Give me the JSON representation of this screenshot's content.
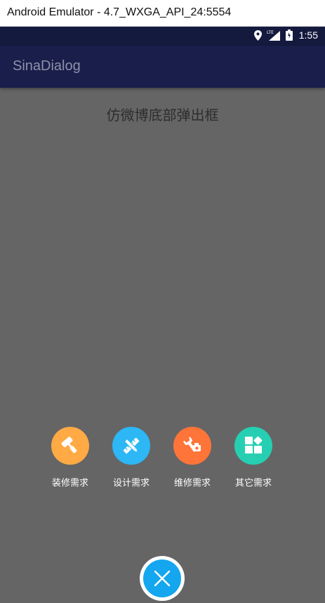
{
  "window": {
    "title": "Android Emulator - 4.7_WXGA_API_24:5554"
  },
  "status_bar": {
    "time": "1:55",
    "network_label": "LTE",
    "icons": [
      "location-pin-icon",
      "signal-icon",
      "battery-icon"
    ],
    "color": "#141a3e"
  },
  "app_bar": {
    "title": "SinaDialog",
    "color": "#191e4b"
  },
  "page": {
    "heading": "仿微博底部弹出框"
  },
  "menu": {
    "items": [
      {
        "label": "装修需求",
        "icon": "paint-roller-icon",
        "color": "#ffaa45"
      },
      {
        "label": "设计需求",
        "icon": "ruler-pencil-icon",
        "color": "#2db7f5"
      },
      {
        "label": "维修需求",
        "icon": "wrench-icon",
        "color": "#ff7438"
      },
      {
        "label": "其它需求",
        "icon": "grid-apps-icon",
        "color": "#27cfb2"
      }
    ]
  },
  "close_button": {
    "icon": "close-icon",
    "color": "#14a6ee"
  },
  "overlay_color": "#656565"
}
